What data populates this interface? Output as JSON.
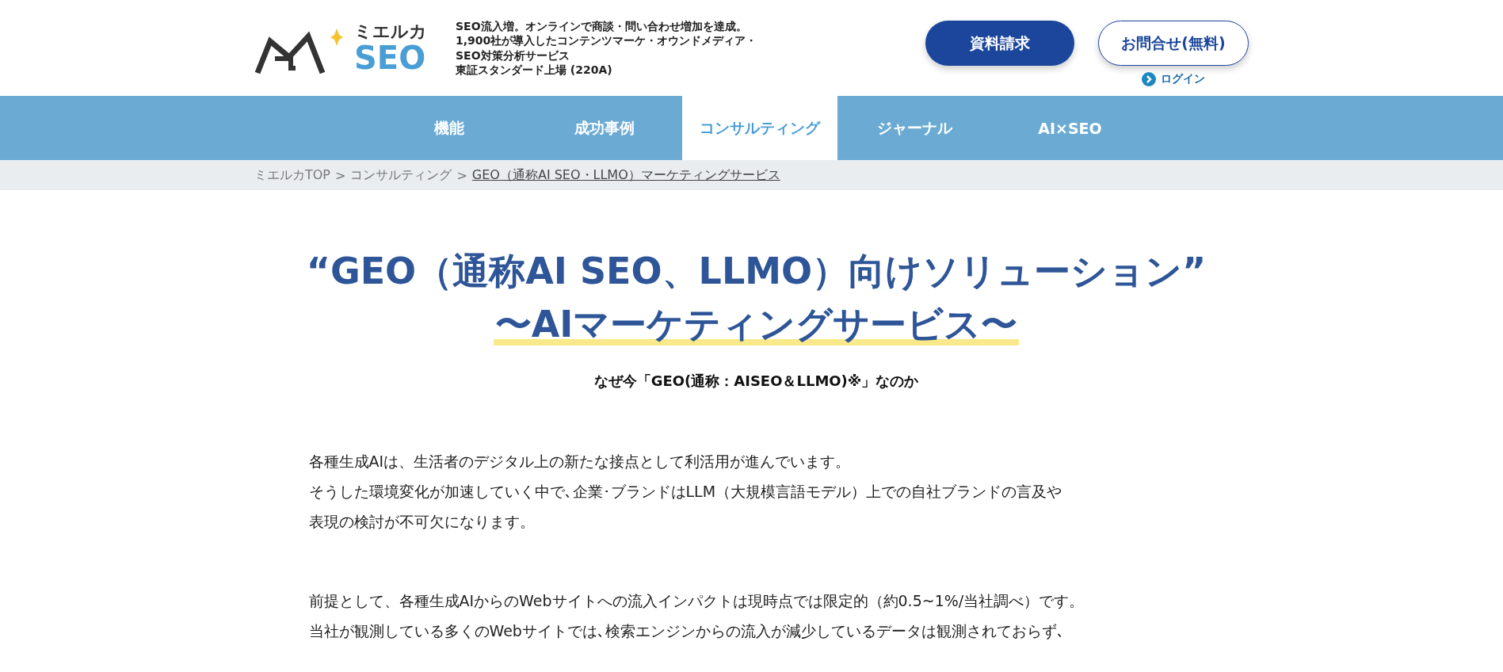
{
  "header": {
    "logo": {
      "brand": "ミエルカ",
      "product": "SEO"
    },
    "tagline": [
      "SEO流入増。オンラインで商談・問い合わせ増加を達成。",
      "1,900社が導入したコンテンツマーケ・オウンドメディア・",
      "SEO対策分析サービス",
      "東証スタンダード上場 (220A)"
    ],
    "buttons": [
      {
        "label": "資料請求",
        "kind": "primary"
      },
      {
        "label": "お問合せ(無料)",
        "kind": "outline"
      }
    ],
    "login": "ログイン"
  },
  "nav": [
    {
      "label": "機能",
      "selected": false
    },
    {
      "label": "成功事例",
      "selected": false
    },
    {
      "label": "コンサルティング",
      "selected": true
    },
    {
      "label": "ジャーナル",
      "selected": false
    },
    {
      "label": "AI×SEO",
      "selected": false
    }
  ],
  "breadcrumb": [
    {
      "label": "ミエルカTOP",
      "current": false
    },
    {
      "label": "コンサルティング",
      "current": false
    },
    {
      "label": "GEO（通称AI SEO・LLMO）マーケティングサービス",
      "current": true
    }
  ],
  "breadcrumb_separator": ">",
  "title": "“GEO（通称AI SEO、LLMO）向けソリューション”",
  "subtitle": "〜AIマーケティングサービス〜",
  "lead": "なぜ今「GEO(通称：AISEO＆LLMO)※」なのか",
  "paragraphs": [
    [
      "各種生成AIは、生活者のデジタル上の新たな接点として利活用が進んでいます。",
      "そうした環境変化が加速していく中で､企業･ブランドはLLM（大規模言語モデル）上での自社ブランドの言及や",
      "表現の検討が不可欠になります。"
    ],
    [
      "前提として、各種生成AIからのWebサイトへの流入インパクトは現時点では限定的（約0.5~1%/当社調べ）です。",
      "当社が観測している多くのWebサイトでは､検索エンジンからの流入が減少しているデータは観測されておらず､"
    ]
  ]
}
